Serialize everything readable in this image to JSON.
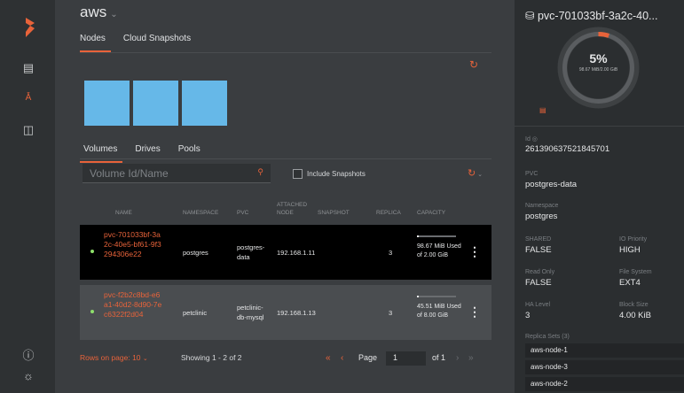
{
  "app": {
    "title": "aws"
  },
  "top_tabs": {
    "nodes": "Nodes",
    "cloud_snapshots": "Cloud Snapshots"
  },
  "bottom_tabs": {
    "volumes": "Volumes",
    "drives": "Drives",
    "pools": "Pools"
  },
  "search": {
    "placeholder": "Volume Id/Name"
  },
  "include_snapshots": "Include Snapshots",
  "table": {
    "headers": {
      "name": "NAME",
      "namespace": "NAMESPACE",
      "pvc": "PVC",
      "attached_node": "ATTACHED NODE",
      "snapshot": "SNAPSHOT",
      "replica": "REPLICA",
      "capacity": "CAPACITY"
    },
    "rows": [
      {
        "name": "pvc-701033bf-3a2c-40e5-bf61-9f3294306e22",
        "namespace": "postgres",
        "pvc": "postgres-data",
        "node": "192.168.1.11",
        "replica": "3",
        "capacity": "98.67 MiB Used of 2.00 GiB",
        "fill": 0.05
      },
      {
        "name": "pvc-f2b2c8bd-e6a1-40d2-8d90-7ec6322f2d04",
        "namespace": "petclinic",
        "pvc": "petclinic-db-mysql",
        "node": "192.168.1.13",
        "replica": "3",
        "capacity": "45.51 MiB Used of 8.00 GiB",
        "fill": 0.01
      }
    ]
  },
  "footer": {
    "rows_per_page": "Rows on page: 10",
    "showing": "Showing 1 - 2 of 2",
    "page_label": "Page",
    "page": "1",
    "of": "of 1"
  },
  "panel": {
    "title": "pvc-701033bf-3a2c-40...",
    "usage_percent": "5%",
    "usage_detail": "98.67 MiB/2.00 GiB",
    "id_label": "Id",
    "id": "261390637521845701",
    "pvc_label": "PVC",
    "pvc": "postgres-data",
    "namespace_label": "Namespace",
    "namespace": "postgres",
    "shared_label": "SHARED",
    "shared": "FALSE",
    "io_priority_label": "IO Priority",
    "io_priority": "HIGH",
    "read_only_label": "Read Only",
    "read_only": "FALSE",
    "filesystem_label": "File System",
    "filesystem": "EXT4",
    "ha_label": "HA Level",
    "ha": "3",
    "block_size_label": "Block Size",
    "block_size": "4.00 KiB",
    "replica_sets_label": "Replica Sets (3)",
    "replica_sets": [
      "aws-node-1",
      "aws-node-3",
      "aws-node-2"
    ]
  },
  "colors": {
    "accent": "#e8633a",
    "node": "#66b8e8",
    "online": "#8ee06b"
  }
}
